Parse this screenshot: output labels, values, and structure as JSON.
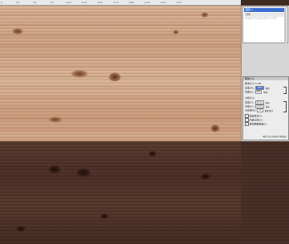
{
  "ruler": {
    "ticks": [
      "0",
      "25",
      "50",
      "75",
      "100",
      "125",
      "150",
      "175",
      "200",
      "225",
      "250",
      "275",
      "300"
    ]
  },
  "layers": {
    "items": [
      {
        "label": "图层 1",
        "selected": true
      },
      {
        "label": "背景",
        "selected": false
      }
    ],
    "watermark": "www.missyuan.com"
  },
  "dialog": {
    "title": "图像大小",
    "pixel_dims": "像素大小:1.2M",
    "width_label": "宽度(W):",
    "width_value": "1024",
    "width_unit": "像素",
    "height_label": "高度(H):",
    "height_value": "683",
    "height_unit": "像素",
    "doc_size": "文档大小:",
    "doc_width_label": "宽度(D):",
    "doc_width_value": "36.12",
    "doc_width_unit": "厘米",
    "doc_height_label": "高度(G):",
    "doc_height_value": "24.09",
    "doc_height_unit": "厘米",
    "resolution_label": "分辨率(R):",
    "resolution_value": "72",
    "resolution_unit": "像素/英寸",
    "checks": [
      "缩放样式(Y)",
      "约束比例(C)",
      "重定图像像素(I):"
    ],
    "resample": "两次立方(适用于平滑渐变)"
  },
  "colors": {
    "light_wood": "#d4ad90",
    "dark_wood": "#4d3128",
    "panel": "#d6d6d6",
    "select": "#3a6ed4"
  }
}
